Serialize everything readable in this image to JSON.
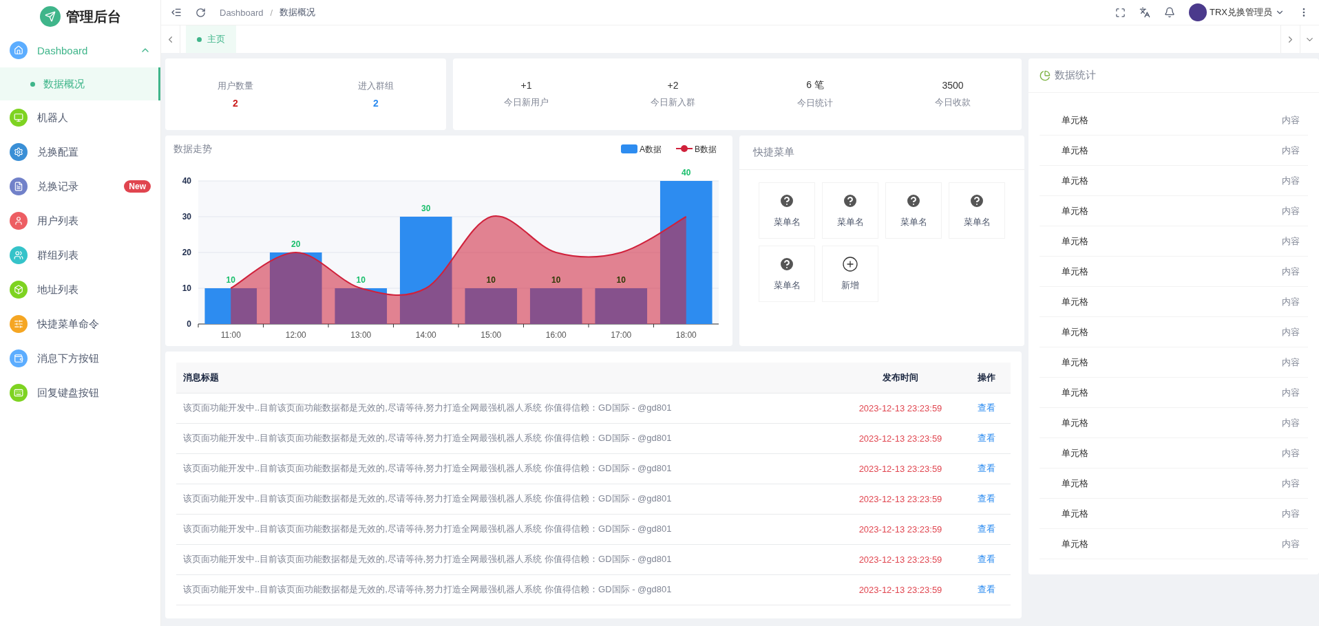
{
  "sidebar": {
    "logo": "管理后台",
    "items": [
      {
        "label": "Dashboard",
        "color": "#5cadff",
        "expanded": true,
        "children": [
          {
            "label": "数据概况",
            "selected": true
          }
        ]
      },
      {
        "label": "机器人",
        "color": "#7ed321"
      },
      {
        "label": "兑换配置",
        "color": "#3a8fd6"
      },
      {
        "label": "兑换记录",
        "color": "#7181c9",
        "badge": "New"
      },
      {
        "label": "用户列表",
        "color": "#ed5e63"
      },
      {
        "label": "群组列表",
        "color": "#35c3c9"
      },
      {
        "label": "地址列表",
        "color": "#7ed321"
      },
      {
        "label": "快捷菜单命令",
        "color": "#f5a623"
      },
      {
        "label": "消息下方按钮",
        "color": "#5cadff"
      },
      {
        "label": "回复键盘按钮",
        "color": "#7ed321"
      }
    ]
  },
  "header": {
    "breadcrumb": [
      "Dashboard",
      "数据概况"
    ],
    "breadcrumb_separator": "/",
    "user": "TRX兑换管理员"
  },
  "tabs": [
    {
      "label": "主页",
      "selected": true
    }
  ],
  "user_stats": [
    {
      "label": "用户数量",
      "value": "2",
      "color": "#cc1f1f"
    },
    {
      "label": "进入群组",
      "value": "2",
      "color": "#2d8cf0"
    }
  ],
  "today_stats": [
    {
      "value": "+1",
      "label": "今日新用户"
    },
    {
      "value": "+2",
      "label": "今日新入群"
    },
    {
      "value": "6 笔",
      "label": "今日统计"
    },
    {
      "value": "3500",
      "label": "今日收款"
    }
  ],
  "chart": {
    "chart_data": {
      "type": "bar",
      "title": "数据走势",
      "categories": [
        "11:00",
        "12:00",
        "13:00",
        "14:00",
        "15:00",
        "16:00",
        "17:00",
        "18:00"
      ],
      "ylim": [
        0,
        40
      ],
      "yticks": [
        0,
        10,
        20,
        30,
        40
      ],
      "grid": true,
      "legend": "top-right",
      "value_labels": [
        [
          "10",
          "20",
          "10",
          "30",
          "10",
          "10",
          "10",
          "40"
        ],
        [
          null,
          null,
          null,
          null,
          null,
          null,
          null,
          null
        ]
      ],
      "series": [
        {
          "name": "A数据",
          "type": "bar",
          "color": "#2d8cf0",
          "values": [
            10,
            20,
            10,
            30,
            10,
            10,
            10,
            40
          ]
        },
        {
          "name": "B数据",
          "type": "area",
          "color": "#d0213b",
          "values": [
            10,
            20,
            10,
            10,
            30,
            20,
            20,
            30
          ]
        }
      ]
    }
  },
  "quick_menu": {
    "title": "快捷菜单",
    "items": [
      {
        "label": "菜单名",
        "kind": "menu"
      },
      {
        "label": "菜单名",
        "kind": "menu"
      },
      {
        "label": "菜单名",
        "kind": "menu"
      },
      {
        "label": "菜单名",
        "kind": "menu"
      },
      {
        "label": "菜单名",
        "kind": "menu"
      },
      {
        "label": "新增",
        "kind": "add"
      }
    ]
  },
  "messages": {
    "columns": [
      "消息标题",
      "发布时间",
      "操作"
    ],
    "rows": [
      {
        "title": "该页面功能开发中..目前该页面功能数据都是无效的,尽请等待,努力打造全网最强机器人系统 你值得信赖：GD国际 - @gd801",
        "time": "2023-12-13 23:23:59",
        "action": "查看"
      },
      {
        "title": "该页面功能开发中..目前该页面功能数据都是无效的,尽请等待,努力打造全网最强机器人系统 你值得信赖：GD国际 - @gd801",
        "time": "2023-12-13 23:23:59",
        "action": "查看"
      },
      {
        "title": "该页面功能开发中..目前该页面功能数据都是无效的,尽请等待,努力打造全网最强机器人系统 你值得信赖：GD国际 - @gd801",
        "time": "2023-12-13 23:23:59",
        "action": "查看"
      },
      {
        "title": "该页面功能开发中..目前该页面功能数据都是无效的,尽请等待,努力打造全网最强机器人系统 你值得信赖：GD国际 - @gd801",
        "time": "2023-12-13 23:23:59",
        "action": "查看"
      },
      {
        "title": "该页面功能开发中..目前该页面功能数据都是无效的,尽请等待,努力打造全网最强机器人系统 你值得信赖：GD国际 - @gd801",
        "time": "2023-12-13 23:23:59",
        "action": "查看"
      },
      {
        "title": "该页面功能开发中..目前该页面功能数据都是无效的,尽请等待,努力打造全网最强机器人系统 你值得信赖：GD国际 - @gd801",
        "time": "2023-12-13 23:23:59",
        "action": "查看"
      },
      {
        "title": "该页面功能开发中..目前该页面功能数据都是无效的,尽请等待,努力打造全网最强机器人系统 你值得信赖：GD国际 - @gd801",
        "time": "2023-12-13 23:23:59",
        "action": "查看"
      }
    ]
  },
  "data_stats": {
    "title": "数据统计",
    "rows": [
      {
        "label": "单元格",
        "value": "内容"
      },
      {
        "label": "单元格",
        "value": "内容"
      },
      {
        "label": "单元格",
        "value": "内容"
      },
      {
        "label": "单元格",
        "value": "内容"
      },
      {
        "label": "单元格",
        "value": "内容"
      },
      {
        "label": "单元格",
        "value": "内容"
      },
      {
        "label": "单元格",
        "value": "内容"
      },
      {
        "label": "单元格",
        "value": "内容"
      },
      {
        "label": "单元格",
        "value": "内容"
      },
      {
        "label": "单元格",
        "value": "内容"
      },
      {
        "label": "单元格",
        "value": "内容"
      },
      {
        "label": "单元格",
        "value": "内容"
      },
      {
        "label": "单元格",
        "value": "内容"
      },
      {
        "label": "单元格",
        "value": "内容"
      },
      {
        "label": "单元格",
        "value": "内容"
      }
    ]
  }
}
